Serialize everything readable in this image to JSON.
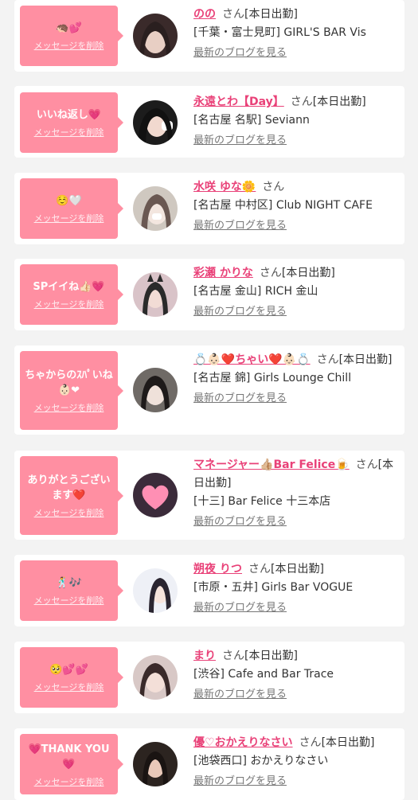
{
  "colors": {
    "page_bg": "#f3f3f3",
    "card_bg": "#ffffff",
    "bubble_pink": "#ff8fa2",
    "name_pink": "#e94178"
  },
  "delete_label": "メッセージを削除",
  "blog_label": "最新のブログを見る",
  "san_label": "さん",
  "items": [
    {
      "message": "🦔💕",
      "name": "のの",
      "status": "[本日出勤]",
      "shop": "[千葉・富士見町] GIRL'S BAR Vis",
      "avatar_colors": [
        "#3a2a2a",
        "#e8cfc4"
      ]
    },
    {
      "message": "いいね返し💗",
      "name": "永遠とわ【Day】",
      "status": "[本日出勤]",
      "shop": "[名古屋 名駅] Seviann",
      "avatar_colors": [
        "#1c1c1c",
        "#f1d9cf"
      ]
    },
    {
      "message": "☺️🤍",
      "name": "水咲 ゆな🌼",
      "status": "",
      "shop": "[名古屋 中村区] Club NIGHT CAFE",
      "avatar_colors": [
        "#cfc8c0",
        "#f3e6df"
      ]
    },
    {
      "message": "SPイイね👍🏻💗",
      "name": "彩瀬 かりな",
      "status": "[本日出勤]",
      "shop": "[名古屋 金山] RICH 金山",
      "avatar_colors": [
        "#d9c3c8",
        "#2a2a2a"
      ]
    },
    {
      "message": "ちゃからのｽﾊﾟいね👶🏻❤",
      "name": "💍👶🏻❤️ちゃい❤️👶🏻💍",
      "status": "[本日出勤]",
      "shop": "[名古屋 錦] Girls Lounge Chill",
      "avatar_colors": [
        "#6f6a66",
        "#efe1da"
      ]
    },
    {
      "message": "ありがとうございます❤️",
      "name": "マネージャー👍🏼Bar Felice🍺",
      "status": "[本日出勤]",
      "shop": "[十三] Bar Felice 十三本店",
      "avatar_colors": [
        "#3b2b3a",
        "#ff8fb4"
      ]
    },
    {
      "message": "🕺🎶",
      "name": "朔夜 りつ",
      "status": "[本日出勤]",
      "shop": "[市原・五井] Girls Bar VOGUE",
      "avatar_colors": [
        "#eef0f6",
        "#2a2530"
      ]
    },
    {
      "message": "🥺💕💕",
      "name": "まり",
      "status": "[本日出勤]",
      "shop": "[渋谷] Cafe and Bar Trace",
      "avatar_colors": [
        "#d8c8c6",
        "#3a2a2a"
      ]
    },
    {
      "message": "💗THANK YOU💗",
      "name": "優♡おかえりなさい",
      "status": "[本日出勤]",
      "shop": "[池袋西口] おかえりなさい",
      "avatar_colors": [
        "#2c2420",
        "#e9c9b9"
      ]
    }
  ]
}
